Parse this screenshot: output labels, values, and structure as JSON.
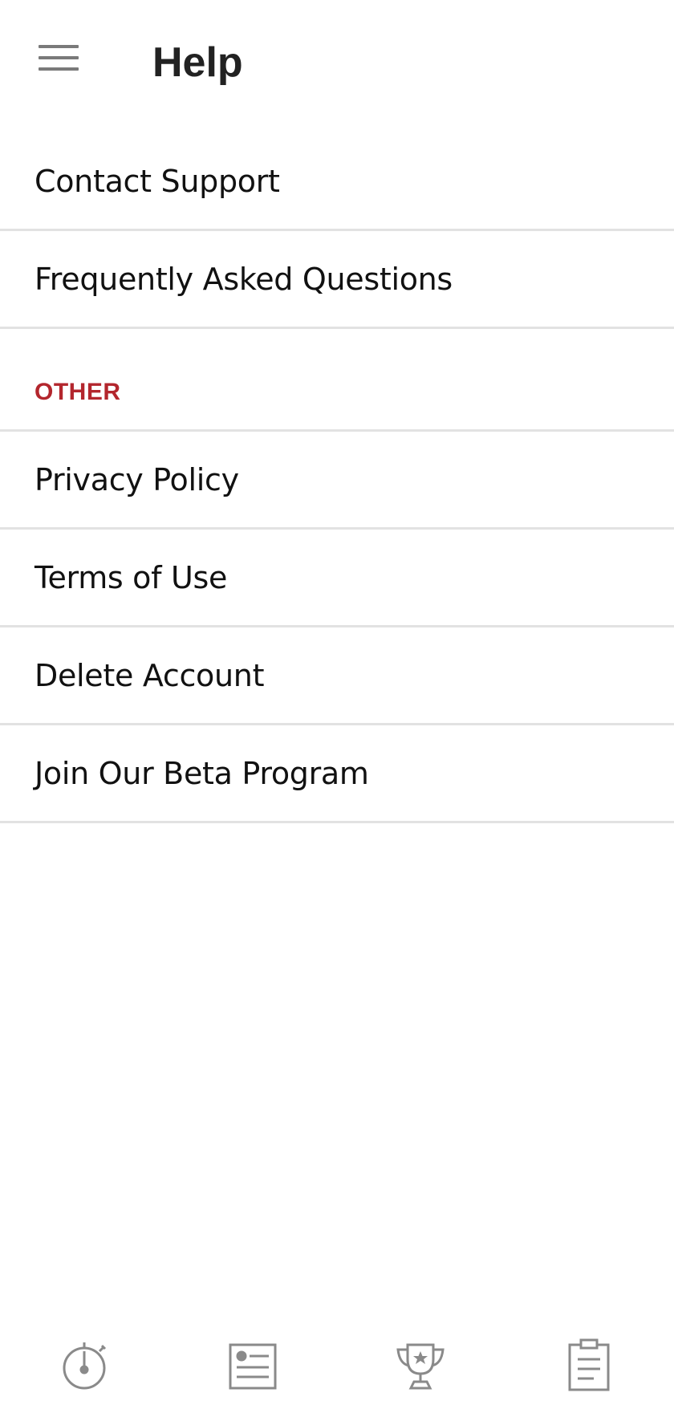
{
  "header": {
    "title": "Help",
    "menu_icon": "hamburger-menu-icon"
  },
  "help_items": [
    {
      "label": "Contact Support"
    },
    {
      "label": "Frequently Asked Questions"
    }
  ],
  "other_section": {
    "heading": "OTHER",
    "heading_color": "#b3262d",
    "items": [
      {
        "label": "Privacy Policy"
      },
      {
        "label": "Terms of Use"
      },
      {
        "label": "Delete Account"
      },
      {
        "label": "Join Our Beta Program"
      }
    ]
  },
  "bottom_nav": {
    "icon_color": "#8a8a8a",
    "items": [
      {
        "icon": "stopwatch-icon"
      },
      {
        "icon": "news-article-icon"
      },
      {
        "icon": "trophy-icon"
      },
      {
        "icon": "clipboard-icon"
      }
    ]
  }
}
